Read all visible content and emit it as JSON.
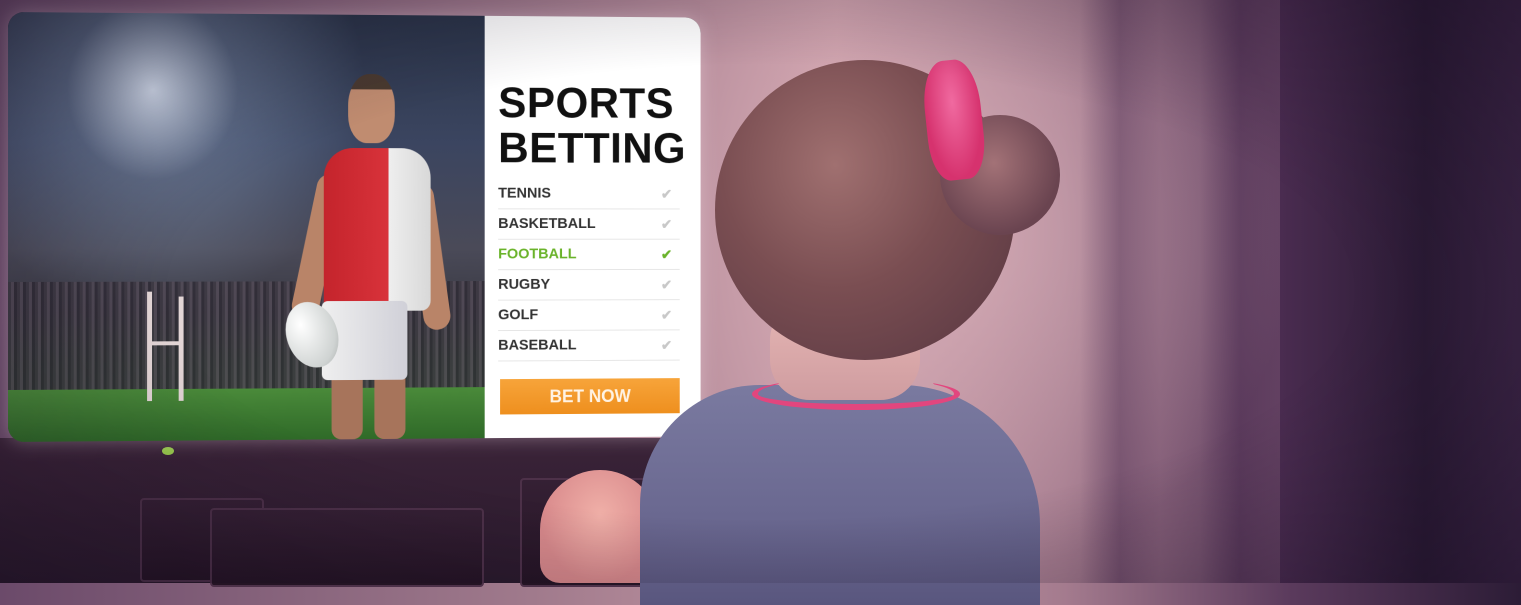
{
  "ad": {
    "title": "SPORTS\nBETTING",
    "menu": [
      {
        "label": "TENNIS",
        "checked": false
      },
      {
        "label": "BASKETBALL",
        "checked": false
      },
      {
        "label": "FOOTBALL",
        "checked": true
      },
      {
        "label": "RUGBY",
        "checked": false
      },
      {
        "label": "GOLF",
        "checked": false
      },
      {
        "label": "BASEBALL",
        "checked": false
      }
    ],
    "cta": "BET NOW",
    "check_glyph": "✔",
    "accent_color": "#6ab32a",
    "button_color": "#f0962a"
  },
  "icons": {
    "check": "check-icon"
  }
}
